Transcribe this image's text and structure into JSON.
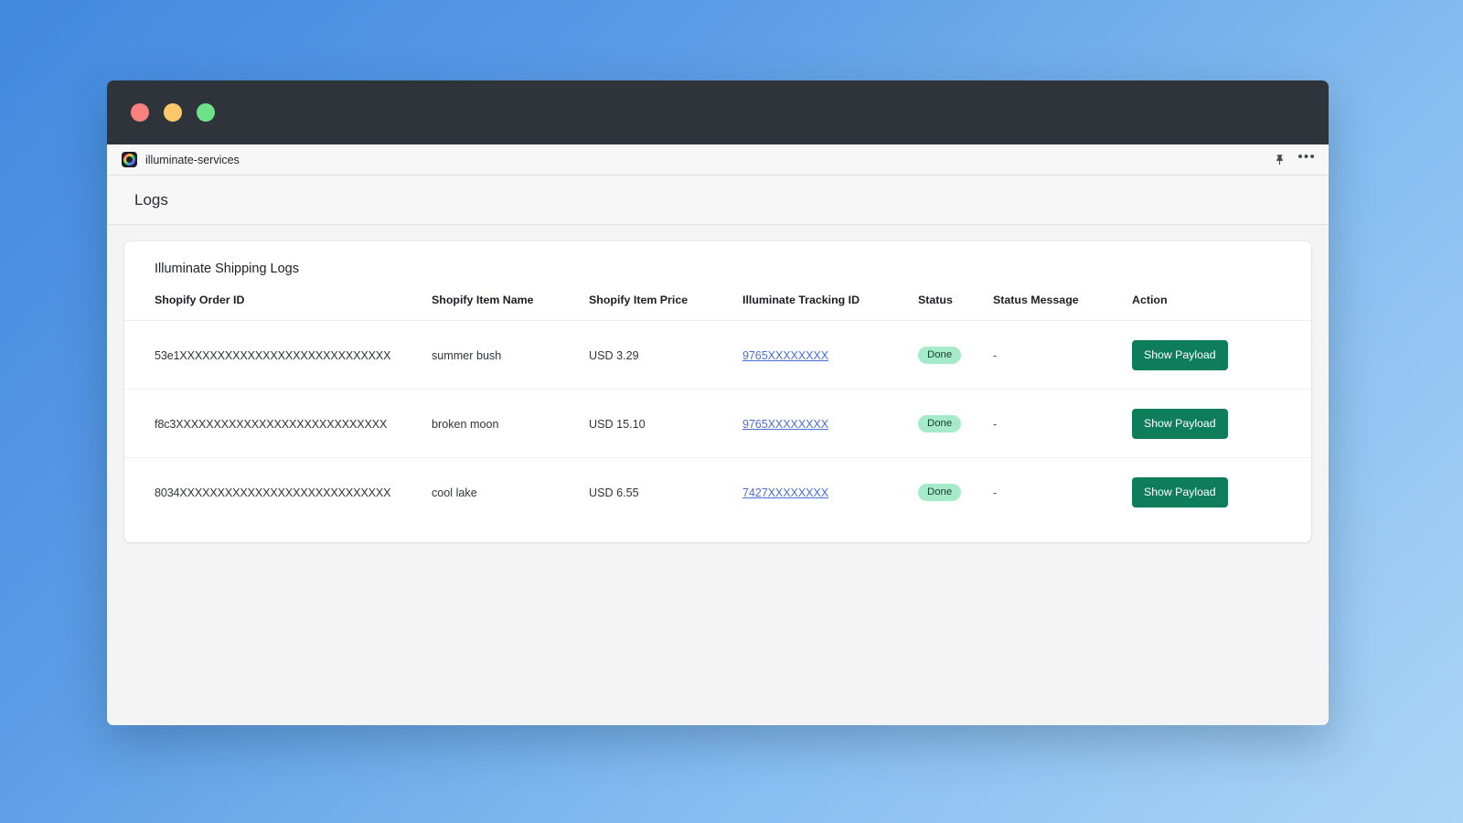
{
  "desktop": {
    "background_from": "#4189df",
    "background_to": "#abd5f7"
  },
  "window": {
    "titlebar_color": "#2f343a",
    "traffic_lights": [
      {
        "name": "close",
        "color": "#f8807f"
      },
      {
        "name": "minimize",
        "color": "#fbc96a"
      },
      {
        "name": "maximize",
        "color": "#6fe08a"
      }
    ]
  },
  "tabstrip": {
    "tab_label": "illuminate-services",
    "app_icon": "illuminate-ring-icon",
    "actions": [
      {
        "name": "pin-icon",
        "label": ""
      },
      {
        "name": "more-options-icon",
        "label": "•••"
      }
    ]
  },
  "header": {
    "title": "Logs"
  },
  "card": {
    "title": "Illuminate Shipping Logs",
    "columns": [
      "Shopify Order ID",
      "Shopify Item Name",
      "Shopify Item Price",
      "Illuminate Tracking ID",
      "Status",
      "Status Message",
      "Action"
    ],
    "rows": [
      {
        "order_id": "53e1XXXXXXXXXXXXXXXXXXXXXXXXXXXX",
        "item_name": "summer bush",
        "item_price": "USD 3.29",
        "tracking_id": "9765XXXXXXXX",
        "status": "Done",
        "status_message": "-",
        "action_label": "Show Payload"
      },
      {
        "order_id": "f8c3XXXXXXXXXXXXXXXXXXXXXXXXXXXX",
        "item_name": "broken moon",
        "item_price": "USD 15.10",
        "tracking_id": "9765XXXXXXXX",
        "status": "Done",
        "status_message": "-",
        "action_label": "Show Payload"
      },
      {
        "order_id": "8034XXXXXXXXXXXXXXXXXXXXXXXXXXXX",
        "item_name": "cool lake",
        "item_price": "USD 6.55",
        "tracking_id": "7427XXXXXXXX",
        "status": "Done",
        "status_message": "-",
        "action_label": "Show Payload"
      }
    ],
    "colors": {
      "badge_bg": "#a6ebc9",
      "badge_text": "#1f3b2e",
      "button_bg": "#0e7d5a",
      "link": "#4a6fdc"
    }
  }
}
